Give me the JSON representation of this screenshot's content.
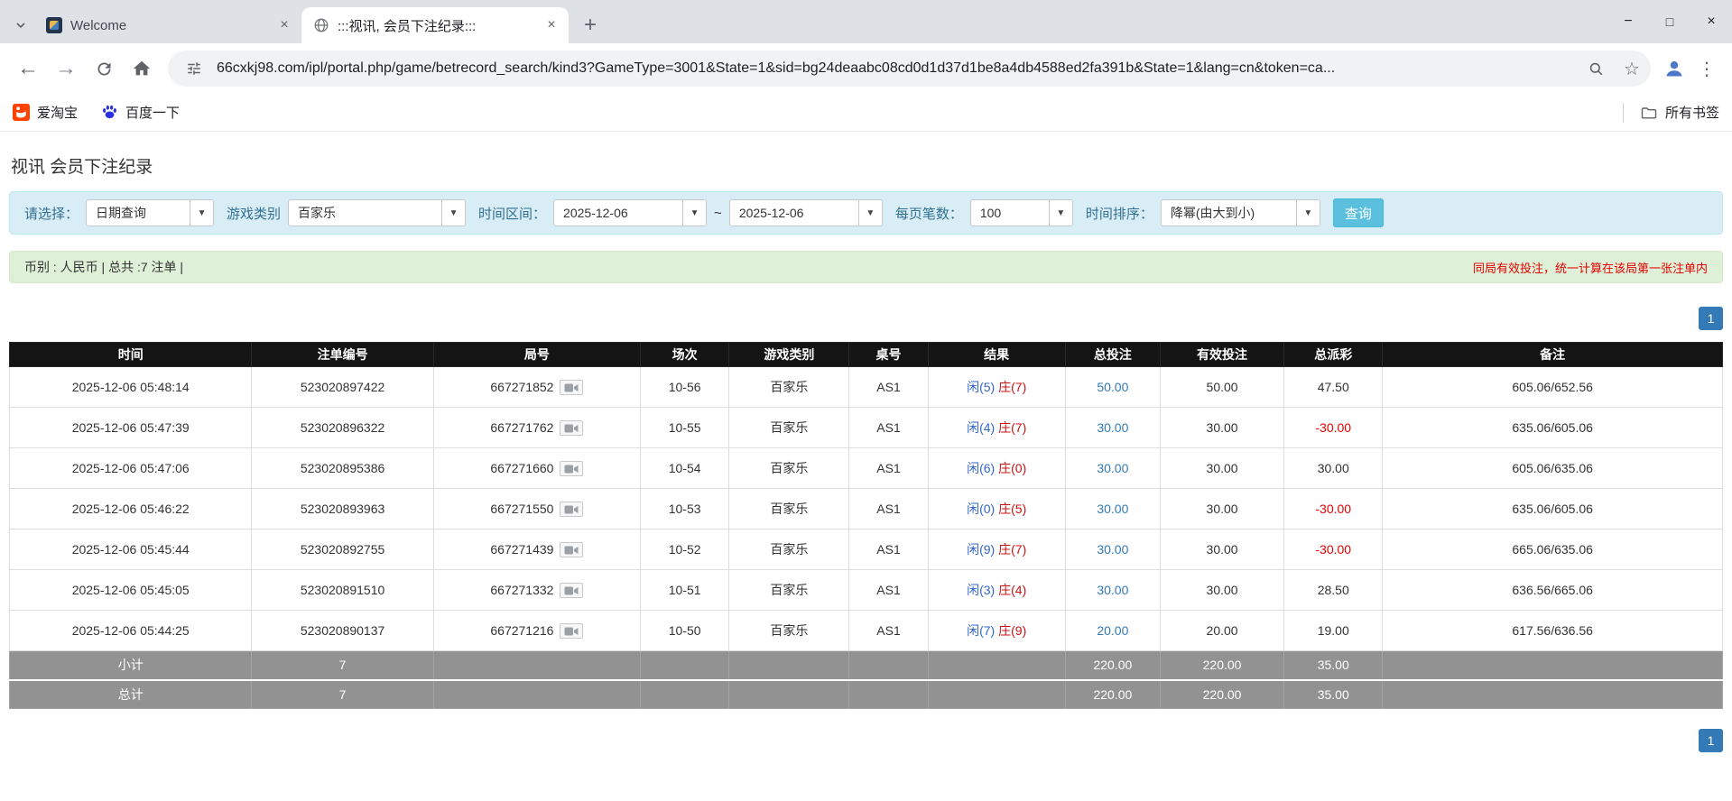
{
  "icons": {
    "close": "×",
    "minimize": "−",
    "maximize": "□",
    "new_tab": "+",
    "back": "←",
    "forward": "→",
    "menu_dots": "⋮",
    "star": "☆",
    "caret_down": "▼"
  },
  "browser": {
    "tabs": [
      {
        "title": "Welcome"
      },
      {
        "title": ":::视讯, 会员下注纪录:::"
      }
    ],
    "url": "66cxkj98.com/ipl/portal.php/game/betrecord_search/kind3?GameType=3001&State=1&sid=bg24deaabc08cd0d1d37d1be8a4db4588ed2fa391b&State=1&lang=cn&token=ca...",
    "bookmarks": {
      "items": [
        {
          "label": "爱淘宝"
        },
        {
          "label": "百度一下"
        }
      ],
      "all_bookmarks_label": "所有书签"
    }
  },
  "page": {
    "title": "视讯 会员下注纪录",
    "filters": {
      "select_label": "请选择：",
      "select_value": "日期查询",
      "game_type_label": "游戏类别",
      "game_type_value": "百家乐",
      "date_range_label": "时间区间：",
      "date_from": "2025-12-06",
      "range_separator": "~",
      "date_to": "2025-12-06",
      "per_page_label": "每页笔数：",
      "per_page_value": "100",
      "sort_label": "时间排序：",
      "sort_value": "降幂(由大到小)",
      "search_button": "查询"
    },
    "info_bar": {
      "summary": "币别 : 人民币 | 总共 :7 注单 |",
      "notice": "同局有效投注，统一计算在该局第一张注单内"
    },
    "pagination": {
      "current": "1"
    },
    "table": {
      "headers": [
        "时间",
        "注单编号",
        "局号",
        "场次",
        "游戏类别",
        "桌号",
        "结果",
        "总投注",
        "有效投注",
        "总派彩",
        "备注"
      ],
      "rows": [
        {
          "time": "2025-12-06 05:48:14",
          "bet_id": "523020897422",
          "round_id": "667271852",
          "session": "10-56",
          "game": "百家乐",
          "table_no": "AS1",
          "result_player": "闲(5)",
          "result_banker": "庄(7)",
          "total_bet": "50.00",
          "valid_bet": "50.00",
          "payout": "47.50",
          "note": "605.06/652.56"
        },
        {
          "time": "2025-12-06 05:47:39",
          "bet_id": "523020896322",
          "round_id": "667271762",
          "session": "10-55",
          "game": "百家乐",
          "table_no": "AS1",
          "result_player": "闲(4)",
          "result_banker": "庄(7)",
          "total_bet": "30.00",
          "valid_bet": "30.00",
          "payout": "-30.00",
          "note": "635.06/605.06"
        },
        {
          "time": "2025-12-06 05:47:06",
          "bet_id": "523020895386",
          "round_id": "667271660",
          "session": "10-54",
          "game": "百家乐",
          "table_no": "AS1",
          "result_player": "闲(6)",
          "result_banker": "庄(0)",
          "total_bet": "30.00",
          "valid_bet": "30.00",
          "payout": "30.00",
          "note": "605.06/635.06"
        },
        {
          "time": "2025-12-06 05:46:22",
          "bet_id": "523020893963",
          "round_id": "667271550",
          "session": "10-53",
          "game": "百家乐",
          "table_no": "AS1",
          "result_player": "闲(0)",
          "result_banker": "庄(5)",
          "total_bet": "30.00",
          "valid_bet": "30.00",
          "payout": "-30.00",
          "note": "635.06/605.06"
        },
        {
          "time": "2025-12-06 05:45:44",
          "bet_id": "523020892755",
          "round_id": "667271439",
          "session": "10-52",
          "game": "百家乐",
          "table_no": "AS1",
          "result_player": "闲(9)",
          "result_banker": "庄(7)",
          "total_bet": "30.00",
          "valid_bet": "30.00",
          "payout": "-30.00",
          "note": "665.06/635.06"
        },
        {
          "time": "2025-12-06 05:45:05",
          "bet_id": "523020891510",
          "round_id": "667271332",
          "session": "10-51",
          "game": "百家乐",
          "table_no": "AS1",
          "result_player": "闲(3)",
          "result_banker": "庄(4)",
          "total_bet": "30.00",
          "valid_bet": "30.00",
          "payout": "28.50",
          "note": "636.56/665.06"
        },
        {
          "time": "2025-12-06 05:44:25",
          "bet_id": "523020890137",
          "round_id": "667271216",
          "session": "10-50",
          "game": "百家乐",
          "table_no": "AS1",
          "result_player": "闲(7)",
          "result_banker": "庄(9)",
          "total_bet": "20.00",
          "valid_bet": "20.00",
          "payout": "19.00",
          "note": "617.56/636.56"
        }
      ],
      "subtotal": {
        "label": "小计",
        "count": "7",
        "total_bet": "220.00",
        "valid_bet": "220.00",
        "payout": "35.00"
      },
      "total": {
        "label": "总计",
        "count": "7",
        "total_bet": "220.00",
        "valid_bet": "220.00",
        "payout": "35.00"
      }
    }
  }
}
